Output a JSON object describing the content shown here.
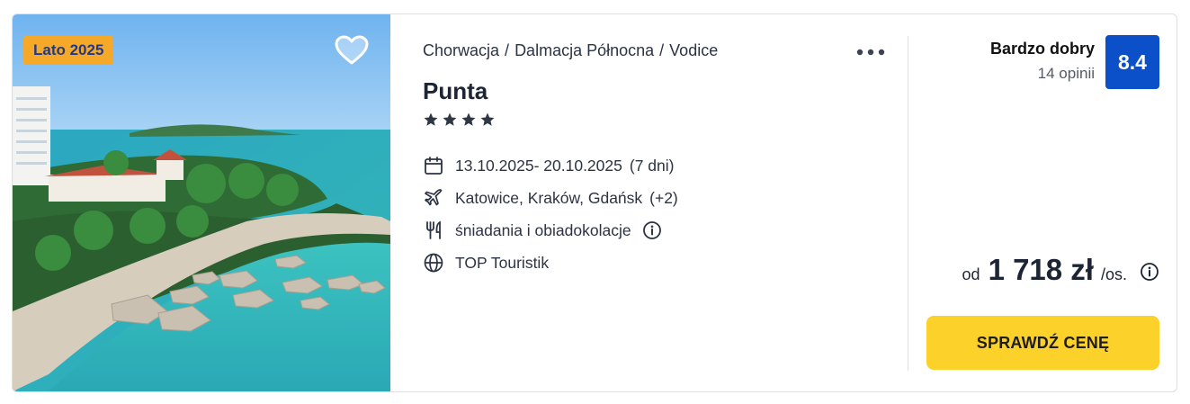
{
  "offer": {
    "season_badge": "Lato 2025",
    "breadcrumb": [
      "Chorwacja",
      "Dalmacja Północna",
      "Vodice"
    ],
    "breadcrumb_separator": "/",
    "hotel_name": "Punta",
    "stars": 4,
    "dates": "13.10.2025- 20.10.2025",
    "duration": "(7 dni)",
    "departures": "Katowice, Kraków, Gdańsk",
    "departures_more": "(+2)",
    "board": "śniadania i obiadokolacje",
    "operator": "TOP Touristik",
    "rating_label": "Bardzo dobry",
    "reviews": "14 opinii",
    "score": "8.4",
    "price_prefix": "od",
    "price": "1 718 zł",
    "price_unit": "/os.",
    "cta_label": "SPRAWDŹ CENĘ"
  },
  "icons": {
    "favorite": "heart-icon",
    "more": "more-dots-icon",
    "dates": "calendar-icon",
    "departures": "plane-icon",
    "board": "cutlery-icon",
    "operator": "globe-icon",
    "info": "info-icon"
  },
  "colors": {
    "badge_bg": "#f6a928",
    "badge_text": "#1f3a8a",
    "score_bg": "#0b4fc9",
    "cta_bg": "#fcd12a",
    "text": "#1d2433"
  }
}
